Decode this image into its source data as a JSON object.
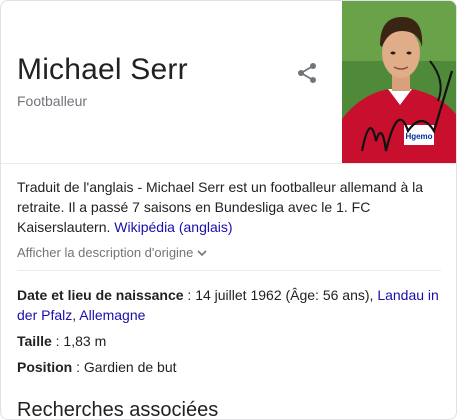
{
  "header": {
    "title": "Michael Serr",
    "subtitle": "Footballeur"
  },
  "photo": {
    "sponsor_text": "Hgemo"
  },
  "description": {
    "text": "Traduit de l'anglais - Michael Serr est un footballeur allemand à la retraite. Il a passé 7 saisons en Bundesliga avec le 1. FC Kaiserslautern.",
    "source_link": "Wikipédia (anglais)",
    "show_original": "Afficher la description d'origine"
  },
  "facts": {
    "birth": {
      "label": "Date et lieu de naissance",
      "value": " : 14 juillet 1962 (Âge: 56 ans), ",
      "link": "Landau in der Pfalz, Allemagne"
    },
    "height": {
      "label": "Taille",
      "value": " : 1,83 m"
    },
    "position": {
      "label": "Position",
      "value": " : Gardien de but"
    }
  },
  "next_section": {
    "title": "Recherches associées"
  },
  "colors": {
    "link": "#1a0dab",
    "secondary": "#70757a",
    "divider": "#ebebeb"
  }
}
